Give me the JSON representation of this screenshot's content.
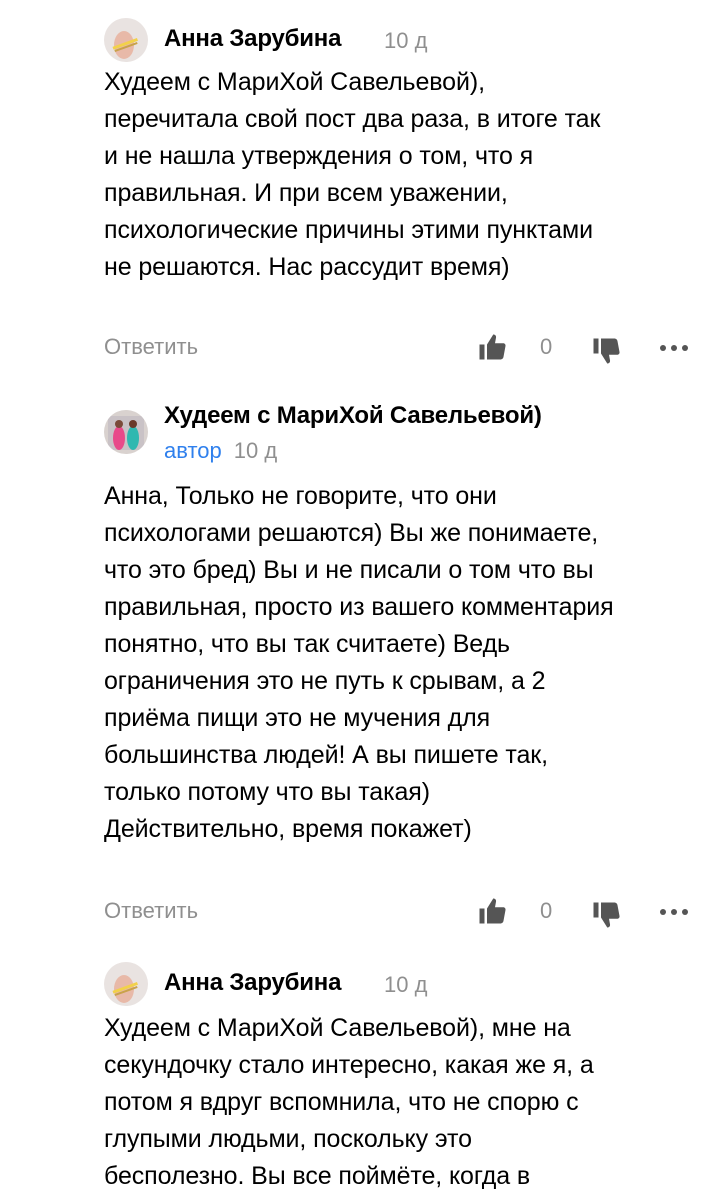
{
  "comments": [
    {
      "author": "Анна Зарубина",
      "time": "10 д",
      "text_lines": [
        "Худеем с МариХой Савельевой),",
        "перечитала свой пост два раза, в итоге так",
        "и не нашла утверждения о том, что я",
        "правильная. И при всем уважении,",
        "психологические причины этими пунктами",
        "не решаются. Нас рассудит время)"
      ],
      "reply_label": "Ответить",
      "like_count": "0"
    },
    {
      "author": "Худеем с МариХой Савельевой)",
      "badge": "автор",
      "time": "10 д",
      "text_lines": [
        "Анна, Только не говорите, что они",
        "психологами решаются) Вы же понимаете,",
        "что это бред) Вы и не писали о том что вы",
        "правильная, просто из вашего комментария",
        "понятно, что вы так считаете) Ведь",
        "ограничения это не путь к срывам, а 2",
        "приёма пищи это не мучения для",
        "большинства людей! А вы пишете так,",
        "только потому что вы такая)",
        "Действительно, время покажет)"
      ],
      "reply_label": "Ответить",
      "like_count": "0"
    },
    {
      "author": "Анна Зарубина",
      "time": "10 д",
      "text_lines": [
        "Худеем с МариХой Савельевой), мне на",
        "секундочку стало интересно, какая же я, а",
        "потом я вдруг вспомнила, что не спорю с",
        "глупыми людьми, поскольку это",
        "бесполезно. Вы все поймёте, когда в"
      ]
    }
  ],
  "icons": {
    "like": "thumbs-up-icon",
    "dislike": "thumbs-down-icon",
    "more": "more-horizontal-icon"
  },
  "colors": {
    "text": "#000000",
    "muted": "#8f8f8f",
    "author_badge": "#2f80ed",
    "icon": "#555555"
  }
}
